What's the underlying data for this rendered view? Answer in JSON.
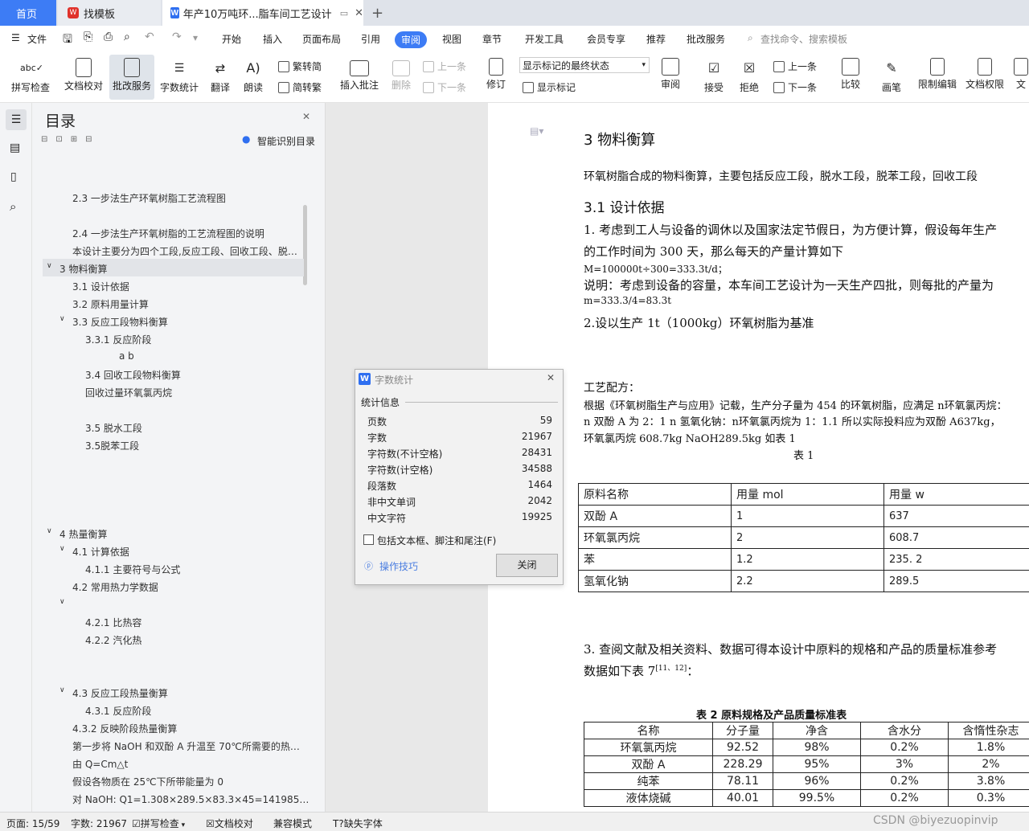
{
  "tabs": {
    "home": "首页",
    "template": "找模板",
    "document": "年产10万吨环...脂车间工艺设计"
  },
  "menu": {
    "file": "文件",
    "items": [
      "开始",
      "插入",
      "页面布局",
      "引用",
      "审阅",
      "视图",
      "章节",
      "开发工具",
      "会员专享",
      "推荐",
      "批改服务"
    ],
    "search": "查找命令、搜索模板"
  },
  "ribbon": {
    "spellcheck": "拼写检查",
    "proofread": "文档校对",
    "correction": "批改服务",
    "wordcount": "字数统计",
    "translate": "翻译",
    "read": "朗读",
    "to_traditional": "繁转简",
    "to_simplified": "简转繁",
    "insert_comment": "插入批注",
    "delete": "删除",
    "prev_comment": "上一条",
    "next_comment": "下一条",
    "track": "修订",
    "markup_select": "显示标记的最终状态",
    "show_markup": "显示标记",
    "review_pane": "审阅",
    "accept": "接受",
    "reject": "拒绝",
    "prev": "上一条",
    "next": "下一条",
    "compare": "比较",
    "pen": "画笔",
    "restrict": "限制编辑",
    "permission": "文档权限",
    "doc_more": "文"
  },
  "toc": {
    "title": "目录",
    "smart": "智能识别目录",
    "items": [
      {
        "text": "2.3  一步法生产环氧树脂工艺流程图"
      },
      {
        "text": "2.4 一步法生产环氧树脂的工艺流程图的说明"
      },
      {
        "text": "本设计主要分为四个工段,反应工段、回收工段、脱…"
      },
      {
        "text": "3  物料衡算"
      },
      {
        "text": "3.1  设计依据"
      },
      {
        "text": "3.2  原料用量计算"
      },
      {
        "text": "3.3  反应工段物料衡算"
      },
      {
        "text": "3.3.1  反应阶段"
      },
      {
        "text": "a             b"
      },
      {
        "text": "3.4 回收工段物料衡算"
      },
      {
        "text": "回收过量环氧氯丙烷"
      },
      {
        "text": "3.5  脱水工段"
      },
      {
        "text": "3.5脱苯工段"
      },
      {
        "text": "4    热量衡算"
      },
      {
        "text": "4.1 计算依据"
      },
      {
        "text": "4.1.1  主要符号与公式"
      },
      {
        "text": "4.2  常用热力学数据"
      },
      {
        "text": "4.2.1  比热容"
      },
      {
        "text": "4.2.2  汽化热"
      },
      {
        "text": "4.3  反应工段热量衡算"
      },
      {
        "text": "4.3.1 反应阶段"
      },
      {
        "text": "4.3.2 反映阶段热量衡算"
      },
      {
        "text": "第一步将 NaOH 和双酚 A 升温至 70℃所需要的热…"
      },
      {
        "text": "由 Q=Cm△t"
      },
      {
        "text": "假设各物质在 25℃下所带能量为 0"
      },
      {
        "text": "对 NaOH:  Q1=1.308×289.5×83.3×45=141985…"
      }
    ]
  },
  "document": {
    "h3": "3  物料衡算",
    "intro": "环氧树脂合成的物料衡算，主要包括反应工段，脱水工段，脱苯工段，回收工段",
    "h31": "3.1  设计依据",
    "p1a": "1. 考虑到工人与设备的调休以及国家法定节假日，为方便计算，假设每年生产",
    "p1b": "的工作时间为 300 天，那么每天的产量计算如下",
    "f1": "M=100000t÷300=333.3t/d；",
    "p2": "说明：考虑到设备的容量，本车间工艺设计为一天生产四批，则每批的产量为",
    "f2": "m=333.3/4=83.3t",
    "p3": "2.设以生产 1t（1000kg）环氧树脂为基准",
    "p4": "工艺配方：",
    "p5": "根据《环氧树脂生产与应用》记载，生产分子量为 454 的环氧树脂，应满足 n环氧氯丙烷：",
    "p6": "n 双酚 A 为 2：1     n 氢氧化钠：n环氧氯丙烷为 1：1.1 所以实际投料应为双酚 A637kg，",
    "p7": "环氧氯丙烷 608.7kg NaOH289.5kg 如表 1",
    "t1_caption": "表 1",
    "t1_header": [
      "原料名称",
      "用量 mol",
      "用量 w"
    ],
    "t1_rows": [
      [
        "双酚 A",
        "1",
        "637"
      ],
      [
        "环氧氯丙烷",
        "2",
        "608.7"
      ],
      [
        "苯",
        "1.2",
        "235. 2"
      ],
      [
        "氢氧化钠",
        "2.2",
        "289.5"
      ]
    ],
    "p8": "3. 查阅文献及相关资料、数据可得本设计中原料的规格和产品的质量标准参考",
    "p9": "数据如下表 7",
    "p9_ref": "[11、12]",
    "p9_end": "：",
    "t2_caption": "表 2    原料规格及产品质量标准表",
    "t2_header": [
      "名称",
      "分子量",
      "净含",
      "含水分",
      "含惰性杂志"
    ],
    "t2_rows": [
      [
        "环氧氯丙烷",
        "92.52",
        "98%",
        "0.2%",
        "1.8%"
      ],
      [
        "双酚 A",
        "228.29",
        "95%",
        "3%",
        "2%"
      ],
      [
        "纯苯",
        "78.11",
        "96%",
        "0.2%",
        "3.8%"
      ],
      [
        "液体烧碱",
        "40.01",
        "99.5%",
        "0.2%",
        "0.3%"
      ]
    ]
  },
  "dialog": {
    "title": "字数统计",
    "section": "统计信息",
    "rows": [
      {
        "label": "页数",
        "value": "59"
      },
      {
        "label": "字数",
        "value": "21967"
      },
      {
        "label": "字符数(不计空格)",
        "value": "28431"
      },
      {
        "label": "字符数(计空格)",
        "value": "34588"
      },
      {
        "label": "段落数",
        "value": "1464"
      },
      {
        "label": "非中文单词",
        "value": "2042"
      },
      {
        "label": "中文字符",
        "value": "19925"
      }
    ],
    "checkbox": "包括文本框、脚注和尾注(F)",
    "tips": "操作技巧",
    "close": "关闭"
  },
  "status": {
    "page": "页面: 15/59",
    "words": "字数: 21967",
    "spell": "拼写检查",
    "proof": "文档校对",
    "compat": "兼容模式",
    "missing_font": "缺失字体",
    "watermark": "CSDN @biyezuopinvip"
  },
  "colors": {
    "accent": "#3d7cf5",
    "panel": "#f3f4f6",
    "canvas": "#e8e8e8"
  }
}
